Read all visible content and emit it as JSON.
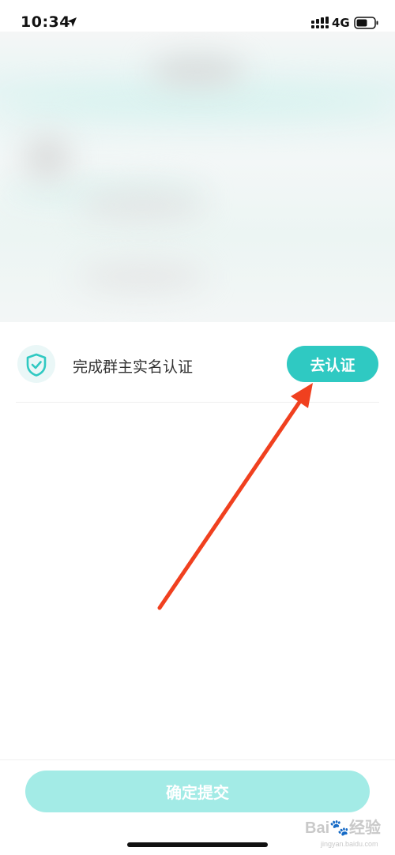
{
  "status_bar": {
    "time": "10:34",
    "network": "4G",
    "icons": [
      "location-arrow-icon",
      "signal-icon",
      "battery-icon"
    ]
  },
  "verification": {
    "label": "完成群主实名认证",
    "button_label": "去认证",
    "icon": "shield-check-icon"
  },
  "footer": {
    "submit_label": "确定提交"
  },
  "watermark": {
    "text": "Bai🐾经验",
    "url": "jingyan.baidu.com"
  },
  "colors": {
    "accent": "#2fc9c2",
    "accent_disabled": "#a3ebe6",
    "annotation_arrow": "#f0401f"
  }
}
